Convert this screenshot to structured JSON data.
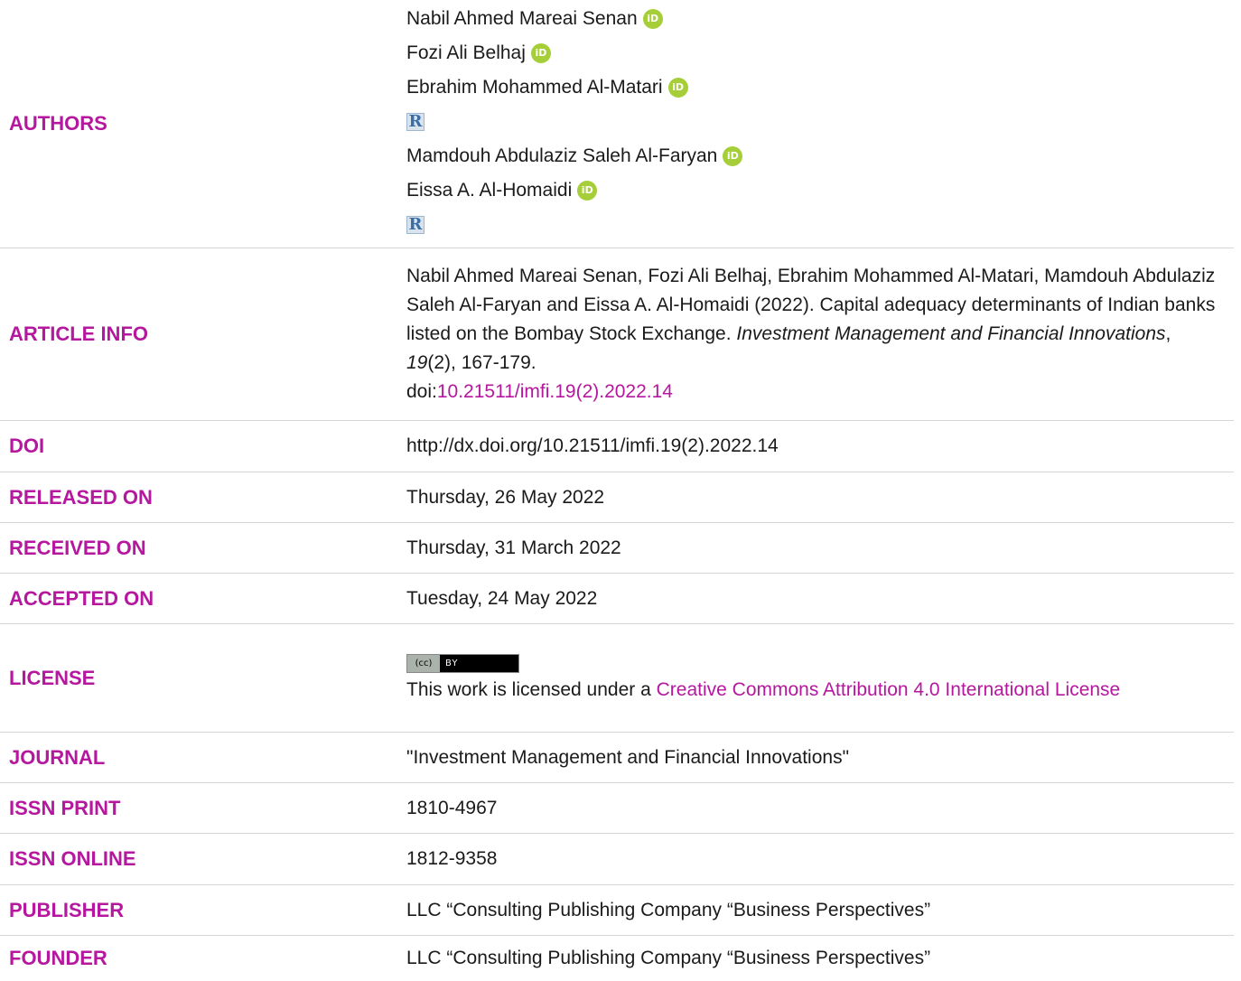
{
  "labels": {
    "authors": "AUTHORS",
    "article_info": "ARTICLE INFO",
    "doi": "DOI",
    "released_on": "RELEASED ON",
    "received_on": "RECEIVED ON",
    "accepted_on": "ACCEPTED ON",
    "license": "LICENSE",
    "journal": "JOURNAL",
    "issn_print": "ISSN PRINT",
    "issn_online": "ISSN ONLINE",
    "publisher": "PUBLISHER",
    "founder": "FOUNDER"
  },
  "authors": [
    "Nabil Ahmed Mareai Senan",
    "Fozi Ali Belhaj",
    "Ebrahim Mohammed Al-Matari",
    "Mamdouh Abdulaziz Saleh Al-Faryan",
    "Eissa A. Al-Homaidi"
  ],
  "icons": {
    "orcid_glyph": "iD",
    "researcherid_glyph": "R",
    "cc_left": "(cc)",
    "cc_right": "BY"
  },
  "article_info": {
    "citation_prefix": "Nabil Ahmed Mareai Senan, Fozi Ali Belhaj, Ebrahim Mohammed Al-Matari, Mamdouh Abdulaziz Saleh Al-Faryan and Eissa A. Al-Homaidi (2022). Capital adequacy determinants of Indian banks listed on the Bombay Stock Exchange. ",
    "journal_italic": "Investment Management and Financial Innovations",
    "sep1": ", ",
    "volume_italic": "19",
    "issue_pages": "(2), 167-179.",
    "doi_prefix": "doi:",
    "doi_link": "10.21511/imfi.19(2).2022.14"
  },
  "doi": "http://dx.doi.org/10.21511/imfi.19(2).2022.14",
  "released_on": "Thursday, 26 May 2022",
  "received_on": "Thursday, 31 March 2022",
  "accepted_on": "Tuesday, 24 May 2022",
  "license": {
    "text": "This work is licensed under a ",
    "link": "Creative Commons Attribution 4.0 International License"
  },
  "journal": "\"Investment Management and Financial Innovations\"",
  "issn_print": "1810-4967",
  "issn_online": "1812-9358",
  "publisher": "LLC “Consulting Publishing Company “Business Perspectives”",
  "founder": "LLC “Consulting Publishing Company “Business Perspectives”",
  "colors": {
    "label_magenta": "#b5179e",
    "orcid_green": "#a6ce39"
  }
}
